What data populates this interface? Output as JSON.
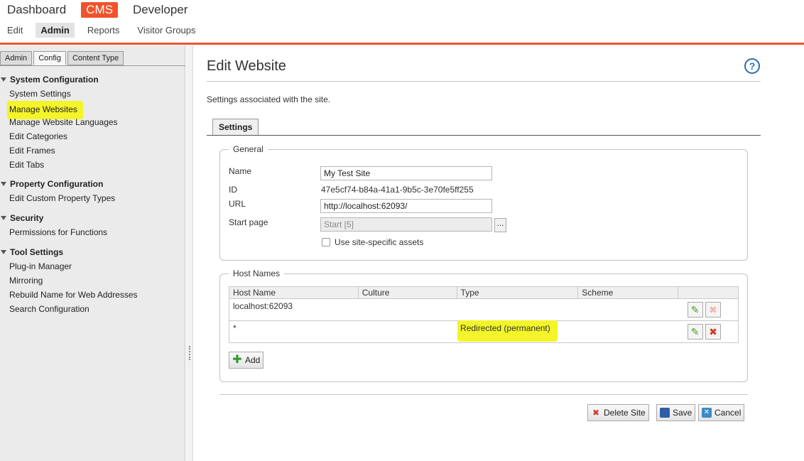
{
  "topnav": {
    "primary": [
      "Dashboard",
      "CMS",
      "Developer"
    ],
    "secondary": [
      "Edit",
      "Admin",
      "Reports",
      "Visitor Groups"
    ]
  },
  "sidebar": {
    "tabs": [
      "Admin",
      "Config",
      "Content Type"
    ],
    "groups": [
      {
        "title": "System Configuration",
        "items": [
          "System Settings",
          "Manage Websites",
          "Manage Website Languages",
          "Edit Categories",
          "Edit Frames",
          "Edit Tabs"
        ]
      },
      {
        "title": "Property Configuration",
        "items": [
          "Edit Custom Property Types"
        ]
      },
      {
        "title": "Security",
        "items": [
          "Permissions for Functions"
        ]
      },
      {
        "title": "Tool Settings",
        "items": [
          "Plug-in Manager",
          "Mirroring",
          "Rebuild Name for Web Addresses",
          "Search Configuration"
        ]
      }
    ]
  },
  "main": {
    "title": "Edit Website",
    "help_label": "?",
    "description": "Settings associated with the site.",
    "tab": "Settings",
    "general": {
      "legend": "General",
      "name_label": "Name",
      "name_value": "My Test Site",
      "id_label": "ID",
      "id_value": "47e5cf74-b84a-41a1-9b5c-3e70fe5ff255",
      "url_label": "URL",
      "url_value": "http://localhost:62093/",
      "start_label": "Start page",
      "start_value": "Start [5]",
      "browse_label": "...",
      "assets_label": "Use site-specific assets"
    },
    "hosts": {
      "legend": "Host Names",
      "columns": [
        "Host Name",
        "Culture",
        "Type",
        "Scheme"
      ],
      "rows": [
        {
          "host": "localhost:62093",
          "culture": "",
          "type": "",
          "scheme": ""
        },
        {
          "host": "*",
          "culture": "",
          "type": "Redirected (permanent)",
          "scheme": ""
        }
      ],
      "add_label": "Add"
    },
    "actions": {
      "delete": "Delete Site",
      "save": "Save",
      "cancel": "Cancel"
    }
  },
  "colors": {
    "accent": "#f0532b",
    "highlight": "#f4f42a",
    "link_blue": "#2a6db5"
  }
}
